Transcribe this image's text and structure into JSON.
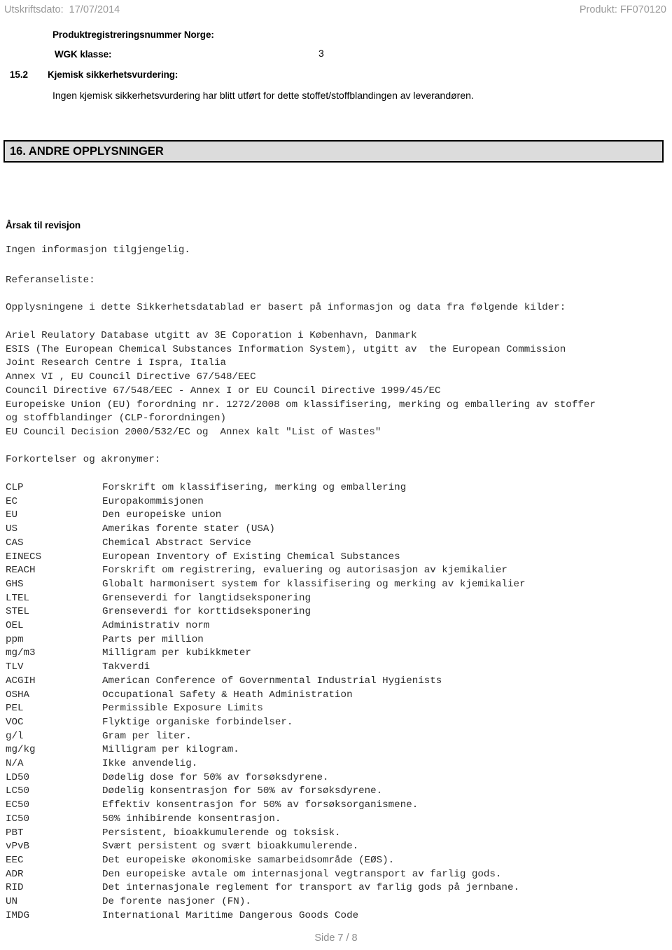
{
  "running_header": {
    "print_date": "Utskriftsdato:  17/07/2014",
    "product": "Produkt: FF070120"
  },
  "section15": {
    "product_registration_label": "Produktregistreringsnummer Norge:",
    "product_registration_value": "",
    "wgk_label": "WGK klasse:",
    "wgk_value": "3",
    "subsection_number": "15.2",
    "subsection_label": "Kjemisk sikkerhetsvurdering:",
    "subsection_text": "Ingen kjemisk sikkerhetsvurdering har blitt utført for dette stoffet/stoffblandingen av leverandøren."
  },
  "section16": {
    "bar_title": "16. ANDRE OPPLYSNINGER",
    "revision_heading": "Årsak til revisjon",
    "revision_text": "Ingen informasjon tilgjengelig.",
    "reference_title": "Referanseliste:",
    "reference_intro": "Opplysningene i dette Sikkerhetsdatablad er basert på informasjon og data fra følgende kilder:",
    "reference_sources": "Ariel Reulatory Database utgitt av 3E Coporation i København, Danmark\nESIS (The European Chemical Substances Information System), utgitt av  the European Commission\nJoint Research Centre i Ispra, Italia\nAnnex VI , EU Council Directive 67/548/EEC\nCouncil Directive 67/548/EEC - Annex I or EU Council Directive 1999/45/EC\nEuropeiske Union (EU) forordning nr. 1272/2008 om klassifisering, merking og emballering av stoffer\nog stoffblandinger (CLP-forordningen)\nEU Council Decision 2000/532/EC og  Annex kalt \"List of Wastes\"",
    "abbreviations_title": "Forkortelser og akronymer:",
    "abbreviations": [
      {
        "abbr": "CLP",
        "meaning": "Forskrift om klassifisering, merking og emballering"
      },
      {
        "abbr": "EC",
        "meaning": "Europakommisjonen"
      },
      {
        "abbr": "EU",
        "meaning": "Den europeiske union"
      },
      {
        "abbr": "US",
        "meaning": "Amerikas forente stater (USA)"
      },
      {
        "abbr": "CAS",
        "meaning": "Chemical Abstract Service"
      },
      {
        "abbr": "EINECS",
        "meaning": "European Inventory of Existing Chemical Substances"
      },
      {
        "abbr": "REACH",
        "meaning": "Forskrift om registrering, evaluering og autorisasjon av kjemikalier"
      },
      {
        "abbr": "GHS",
        "meaning": "Globalt harmonisert system for klassifisering og merking av kjemikalier"
      },
      {
        "abbr": "LTEL",
        "meaning": "Grenseverdi for langtidseksponering"
      },
      {
        "abbr": "STEL",
        "meaning": "Grenseverdi for korttidseksponering"
      },
      {
        "abbr": "OEL",
        "meaning": "Administrativ norm"
      },
      {
        "abbr": "ppm",
        "meaning": "Parts per million"
      },
      {
        "abbr": "mg/m3",
        "meaning": "Milligram per kubikkmeter"
      },
      {
        "abbr": "TLV",
        "meaning": "Takverdi"
      },
      {
        "abbr": "ACGIH",
        "meaning": "American Conference of Governmental Industrial Hygienists"
      },
      {
        "abbr": "OSHA",
        "meaning": "Occupational Safety & Heath Administration"
      },
      {
        "abbr": "PEL",
        "meaning": "Permissible Exposure Limits"
      },
      {
        "abbr": "VOC",
        "meaning": "Flyktige organiske forbindelser."
      },
      {
        "abbr": "g/l",
        "meaning": "Gram per liter."
      },
      {
        "abbr": "mg/kg",
        "meaning": "Milligram per kilogram."
      },
      {
        "abbr": "N/A",
        "meaning": "Ikke anvendelig."
      },
      {
        "abbr": "LD50",
        "meaning": "Dødelig dose for 50% av forsøksdyrene."
      },
      {
        "abbr": "LC50",
        "meaning": "Dødelig konsentrasjon for 50% av forsøksdyrene."
      },
      {
        "abbr": "EC50",
        "meaning": "Effektiv konsentrasjon for 50% av forsøksorganismene."
      },
      {
        "abbr": "IC50",
        "meaning": "50% inhibirende konsentrasjon."
      },
      {
        "abbr": "PBT",
        "meaning": "Persistent, bioakkumulerende og toksisk."
      },
      {
        "abbr": "vPvB",
        "meaning": "Svært persistent og svært bioakkumulerende."
      },
      {
        "abbr": "EEC",
        "meaning": "Det europeiske økonomiske samarbeidsområde (EØS)."
      },
      {
        "abbr": "ADR",
        "meaning": "Den europeiske avtale om internasjonal vegtransport av farlig gods."
      },
      {
        "abbr": "RID",
        "meaning": "Det internasjonale reglement for transport av farlig gods på jernbane."
      },
      {
        "abbr": "UN",
        "meaning": "De forente nasjoner (FN)."
      },
      {
        "abbr": "IMDG",
        "meaning": "International Maritime Dangerous Goods Code"
      }
    ]
  },
  "footer": {
    "page_label": "Side 7 / 8"
  },
  "colors": {
    "header_bar_fill": "#dcdcdc",
    "header_bar_border": "#000000",
    "running_header_text": "#9a9a9a",
    "body_text": "#2b2b2b",
    "footer_text": "#8d8d8d"
  }
}
